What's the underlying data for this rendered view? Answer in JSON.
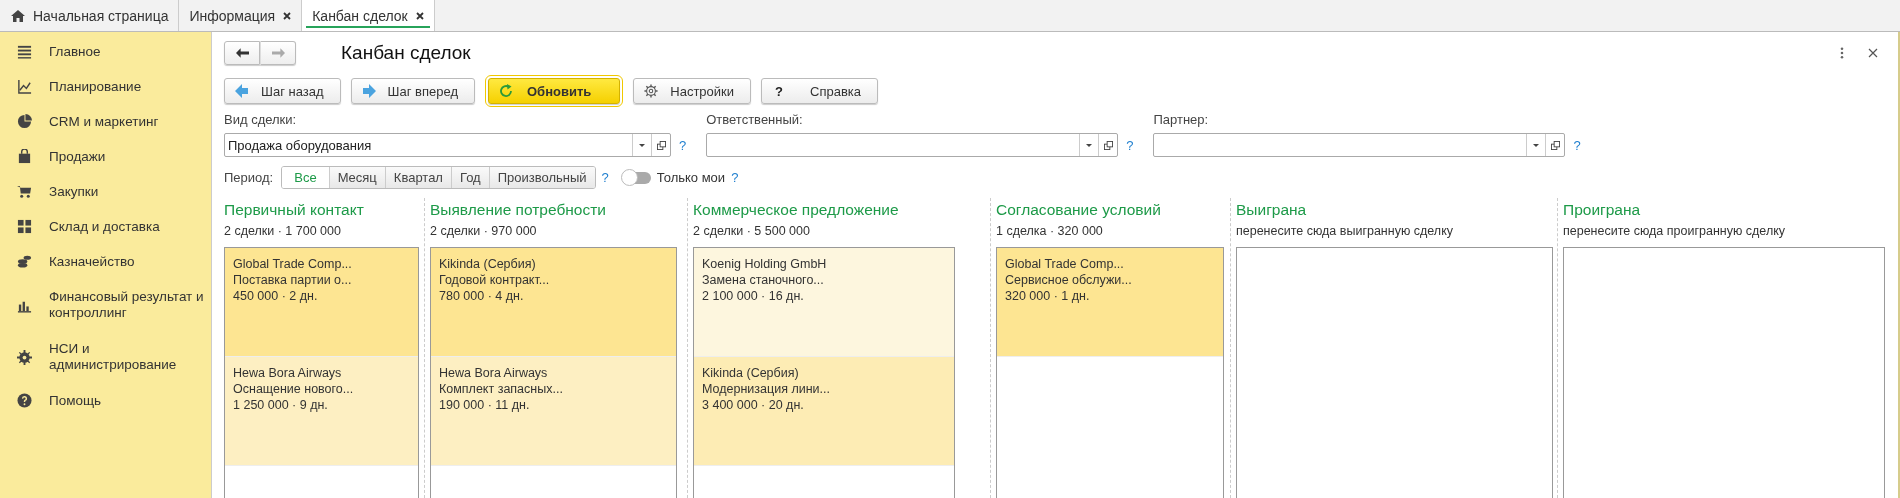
{
  "tabs": [
    {
      "label": "Начальная страница",
      "kind": "home",
      "selected": false
    },
    {
      "label": "Информация",
      "kind": "document",
      "selected": false
    },
    {
      "label": "Канбан сделок",
      "kind": "document",
      "selected": true
    }
  ],
  "sidebar": {
    "items": [
      {
        "label": "Главное"
      },
      {
        "label": "Планирование"
      },
      {
        "label": "CRM и маркетинг"
      },
      {
        "label": "Продажи"
      },
      {
        "label": "Закупки"
      },
      {
        "label": "Склад и доставка"
      },
      {
        "label": "Казначейство"
      },
      {
        "label": "Финансовый результат и контроллинг"
      },
      {
        "label": "НСИ и администрирование"
      },
      {
        "label": "Помощь"
      }
    ]
  },
  "form": {
    "title": "Канбан сделок",
    "toolbar": [
      {
        "label": "Шаг назад",
        "kind": "back",
        "default": false
      },
      {
        "label": "Шаг вперед",
        "kind": "forward",
        "default": false
      },
      {
        "label": "Обновить",
        "kind": "refresh",
        "default": true
      },
      {
        "label": "Настройки",
        "kind": "settings",
        "default": false
      },
      {
        "label": "Справка",
        "kind": "help",
        "icon_text": "?",
        "default": false
      }
    ],
    "filters": [
      {
        "label": "Вид сделки:",
        "value": "Продажа оборудования",
        "help": "?"
      },
      {
        "label": "Ответственный:",
        "help": "?"
      },
      {
        "label": "Партнер:",
        "help": "?"
      }
    ],
    "period": {
      "label": "Период:",
      "help": "?",
      "options": [
        {
          "label": "Все",
          "selected": true
        },
        {
          "label": "Месяц",
          "selected": false
        },
        {
          "label": "Квартал",
          "selected": false
        },
        {
          "label": "Год",
          "selected": false
        },
        {
          "label": "Произвольный",
          "selected": false
        }
      ]
    },
    "only_mine": {
      "label": "Только мои",
      "on": false,
      "help": "?"
    },
    "columns": [
      {
        "title": "Первичный контакт",
        "summary": "2 сделки · 1 700 000",
        "cards": [
          {
            "company": "Global Trade Comp...",
            "deal": "Поставка партии о...",
            "info": "450 000 · 2 дн.",
            "color": "#fde592"
          },
          {
            "company": "Hewa Bora Airways",
            "deal": "Оснащение нового...",
            "info": "1 250 000 · 9 дн.",
            "color": "#fdefc2"
          }
        ]
      },
      {
        "title": "Выявление потребности",
        "summary": "2 сделки · 970 000",
        "cards": [
          {
            "company": "Kikinda (Сербия)",
            "deal": "Годовой контракт...",
            "info": "780 000 · 4 дн.",
            "color": "#fde592"
          },
          {
            "company": "Hewa Bora Airways",
            "deal": "Комплект запасных...",
            "info": "190 000 · 11 дн.",
            "color": "#fdefc2"
          }
        ]
      },
      {
        "title": "Коммерческое предложение",
        "summary": "2 сделки · 5 500 000",
        "cards": [
          {
            "company": "Koenig Holding GmbH",
            "deal": "Замена станочного...",
            "info": "2 100 000 · 16 дн.",
            "color": "#fdf6de"
          },
          {
            "company": "Kikinda (Сербия)",
            "deal": "Модернизация лини...",
            "info": "3 400 000 · 20 дн.",
            "color": "#fdecb4"
          }
        ]
      },
      {
        "title": "Согласование условий",
        "summary": "1 сделка · 320 000",
        "cards": [
          {
            "company": "Global Trade Comp...",
            "deal": "Сервисное обслужи...",
            "info": "320 000 · 1 дн.",
            "color": "#fde592"
          }
        ]
      },
      {
        "title": "Выиграна",
        "summary": "перенесите сюда выигранную сделку"
      },
      {
        "title": "Проиграна",
        "summary": "перенесите сюда проигранную сделку"
      }
    ]
  }
}
